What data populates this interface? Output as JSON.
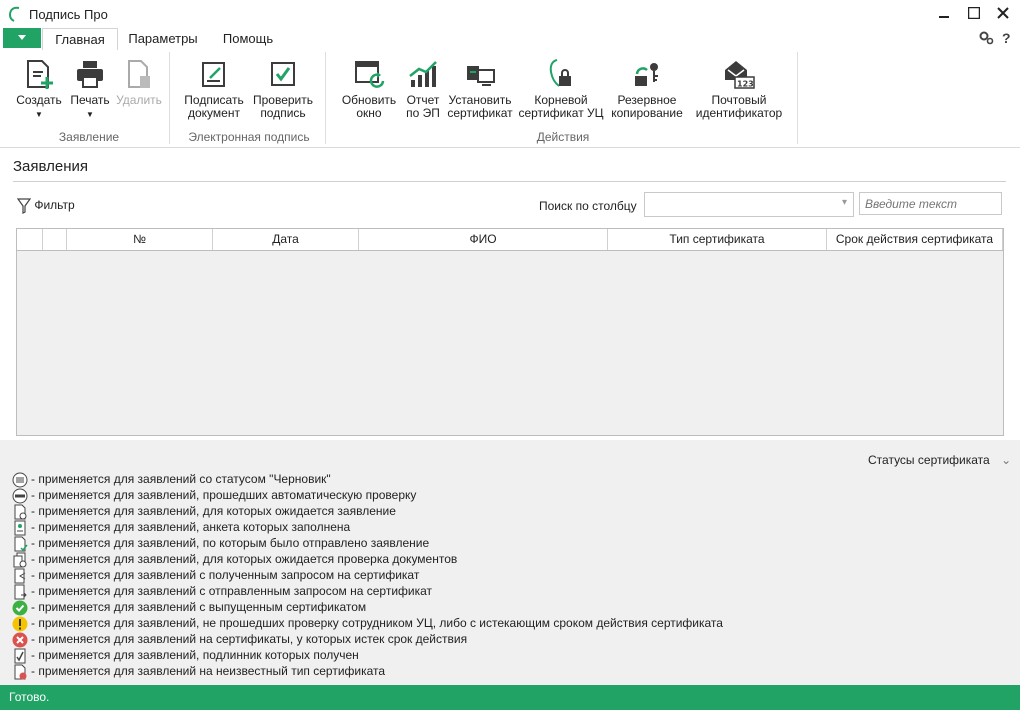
{
  "app": {
    "title": "Подпись Про"
  },
  "tabs": [
    "Главная",
    "Параметры",
    "Помощь"
  ],
  "ribbon": {
    "statement": {
      "group": "Заявление",
      "create": "Создать",
      "print": "Печать",
      "delete": "Удалить"
    },
    "signature": {
      "group": "Электронная подпись",
      "sign": [
        "Подписать",
        "документ"
      ],
      "verify": [
        "Проверить",
        "подпись"
      ]
    },
    "actions": {
      "group": "Действия",
      "refresh": [
        "Обновить",
        "окно"
      ],
      "report": [
        "Отчет",
        "по ЭП"
      ],
      "install": [
        "Установить",
        "сертификат"
      ],
      "root": [
        "Корневой",
        "сертификат УЦ"
      ],
      "backup": [
        "Резервное",
        "копирование"
      ],
      "postal": [
        "Почтовый",
        "идентификатор"
      ]
    }
  },
  "main": {
    "title": "Заявления",
    "filter_label": "Фильтр",
    "search_by_column_label": "Поиск по столбцу",
    "search_placeholder": "Введите текст",
    "columns": [
      "№",
      "Дата",
      "ФИО",
      "Тип сертификата",
      "Срок действия сертификата"
    ]
  },
  "legend": {
    "title": "Статусы сертификата",
    "items": [
      "- применяется для заявлений со статусом \"Черновик\"",
      "- применяется для заявлений, прошедших автоматическую проверку",
      "- применяется для заявлений, для которых ожидается заявление",
      "- применяется для заявлений, анкета которых заполнена",
      "- применяется для заявлений, по которым было отправлено заявление",
      "- применяется для заявлений, для которых ожидается проверка документов",
      "- применяется для заявлений с полученным запросом на сертификат",
      "- применяется для заявлений с отправленным запросом на сертификат",
      "- применяется для заявлений с выпущенным сертификатом",
      "- применяется для заявлений, не прошедших проверку сотрудником УЦ, либо с истекающим сроком действия сертификата",
      "- применяется для заявлений на сертификаты, у которых истек срок действия",
      "- применяется для заявлений, подлинник которых получен",
      "- применяется для заявлений на неизвестный тип сертификата"
    ]
  },
  "status": "Готово.",
  "colors": {
    "accent": "#21a366",
    "icon": "#3c3c3c",
    "ok": "#3cb043",
    "warn": "#f5c400",
    "error": "#d9534f"
  }
}
